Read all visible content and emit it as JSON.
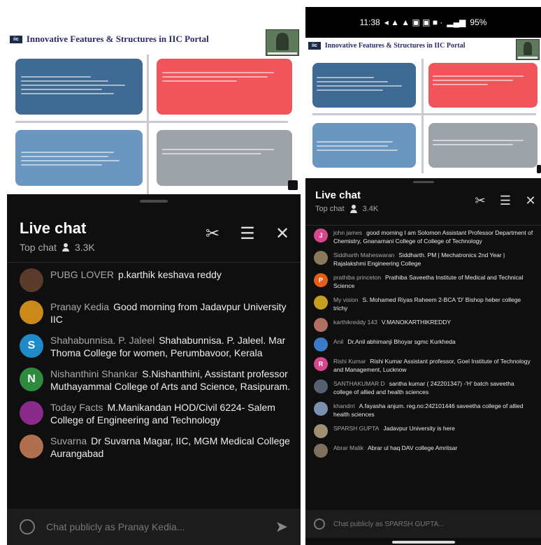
{
  "slide": {
    "badge": "iic",
    "title": "Innovative Features & Structures in IIC Portal"
  },
  "left": {
    "chat": {
      "title": "Live chat",
      "mode": "Top chat",
      "viewers": "3.3K",
      "placeholder": "Chat publicly as Pranay Kedia...",
      "messages": [
        {
          "author": "PUBG LOVER",
          "text": "p.karthik keshava reddy",
          "avatar_letter": "",
          "avatar_color": "#5a3a2a"
        },
        {
          "author": "Pranay Kedia",
          "text": "Good morning from Jadavpur University IIC",
          "avatar_letter": "",
          "avatar_color": "#c98a1a"
        },
        {
          "author": "Shahabunnisa. P. Jaleel",
          "text": "Shahabunnisa. P. Jaleel. Mar Thoma College for women, Perumbavoor, Kerala",
          "avatar_letter": "S",
          "avatar_color": "#1e8ac8"
        },
        {
          "author": "Nishanthini Shankar",
          "text": "S.Nishanthini, Assistant professor Muthayammal College of Arts and Science, Rasipuram.",
          "avatar_letter": "N",
          "avatar_color": "#2e8b3e"
        },
        {
          "author": "Today Facts",
          "text": "M.Manikandan HOD/Civil 6224- Salem College of Engineering and Technology",
          "avatar_letter": "",
          "avatar_color": "#8a2a8a"
        },
        {
          "author": "Suvarna",
          "text": "Dr Suvarna Magar, IIC, MGM Medical College Aurangabad",
          "avatar_letter": "",
          "avatar_color": "#b07050"
        }
      ]
    }
  },
  "right": {
    "status": {
      "time": "11:38",
      "battery": "95%"
    },
    "chat": {
      "title": "Live chat",
      "mode": "Top chat",
      "viewers": "3.4K",
      "placeholder": "Chat publicly as SPARSH GUPTA...",
      "messages": [
        {
          "author": "john james",
          "text": "good morning I am Solomon Assistant Professor Department of Chemistry, Gnanamani College of College of Technology",
          "avatar_letter": "J",
          "avatar_color": "#d8478e"
        },
        {
          "author": "Siddharth Maheswaran",
          "text": "Siddharth. PM | Mechatronics 2nd Year | Rajalakshmi Engineering College",
          "avatar_letter": "",
          "avatar_color": "#8a7a5a"
        },
        {
          "author": "prathiba princeton",
          "text": "Prathiba Saveetha Institute of Medical and Technical Science",
          "avatar_letter": "P",
          "avatar_color": "#e0601a"
        },
        {
          "author": "My vision",
          "text": "S. Mohamed Riyas Raheem 2-BCA 'D' Bishop heber college trichy",
          "avatar_letter": "",
          "avatar_color": "#c8a020"
        },
        {
          "author": "karthikreddy 143",
          "text": "V.MANOKARTHIKREDDY",
          "avatar_letter": "",
          "avatar_color": "#b07060"
        },
        {
          "author": "Anil",
          "text": "Dr.Anil abhimanji Bhoyar sgmc Kurkheda",
          "avatar_letter": "",
          "avatar_color": "#3a7ac8"
        },
        {
          "author": "Rishi Kumar",
          "text": "Rishi Kumar Assistant professor, Goel Institute of Technology and Management, Lucknow",
          "avatar_letter": "R",
          "avatar_color": "#d8478e"
        },
        {
          "author": "SANTHAKUMAR D",
          "text": "santha kumar ( 242201347) -'H' batch saveetha college of allied and health sciences",
          "avatar_letter": "",
          "avatar_color": "#556070"
        },
        {
          "author": "khandrri",
          "text": "A.fayasha anjum. reg.no:242101446 saveetha college of allied health sciences",
          "avatar_letter": "",
          "avatar_color": "#7a90b0"
        },
        {
          "author": "SPARSH GUPTA",
          "text": "Jadavpur University is here",
          "avatar_letter": "",
          "avatar_color": "#a09070"
        },
        {
          "author": "Abrar Malik",
          "text": "Abrar ul haq DAV college Amritsar",
          "avatar_letter": "",
          "avatar_color": "#807060"
        }
      ]
    }
  }
}
